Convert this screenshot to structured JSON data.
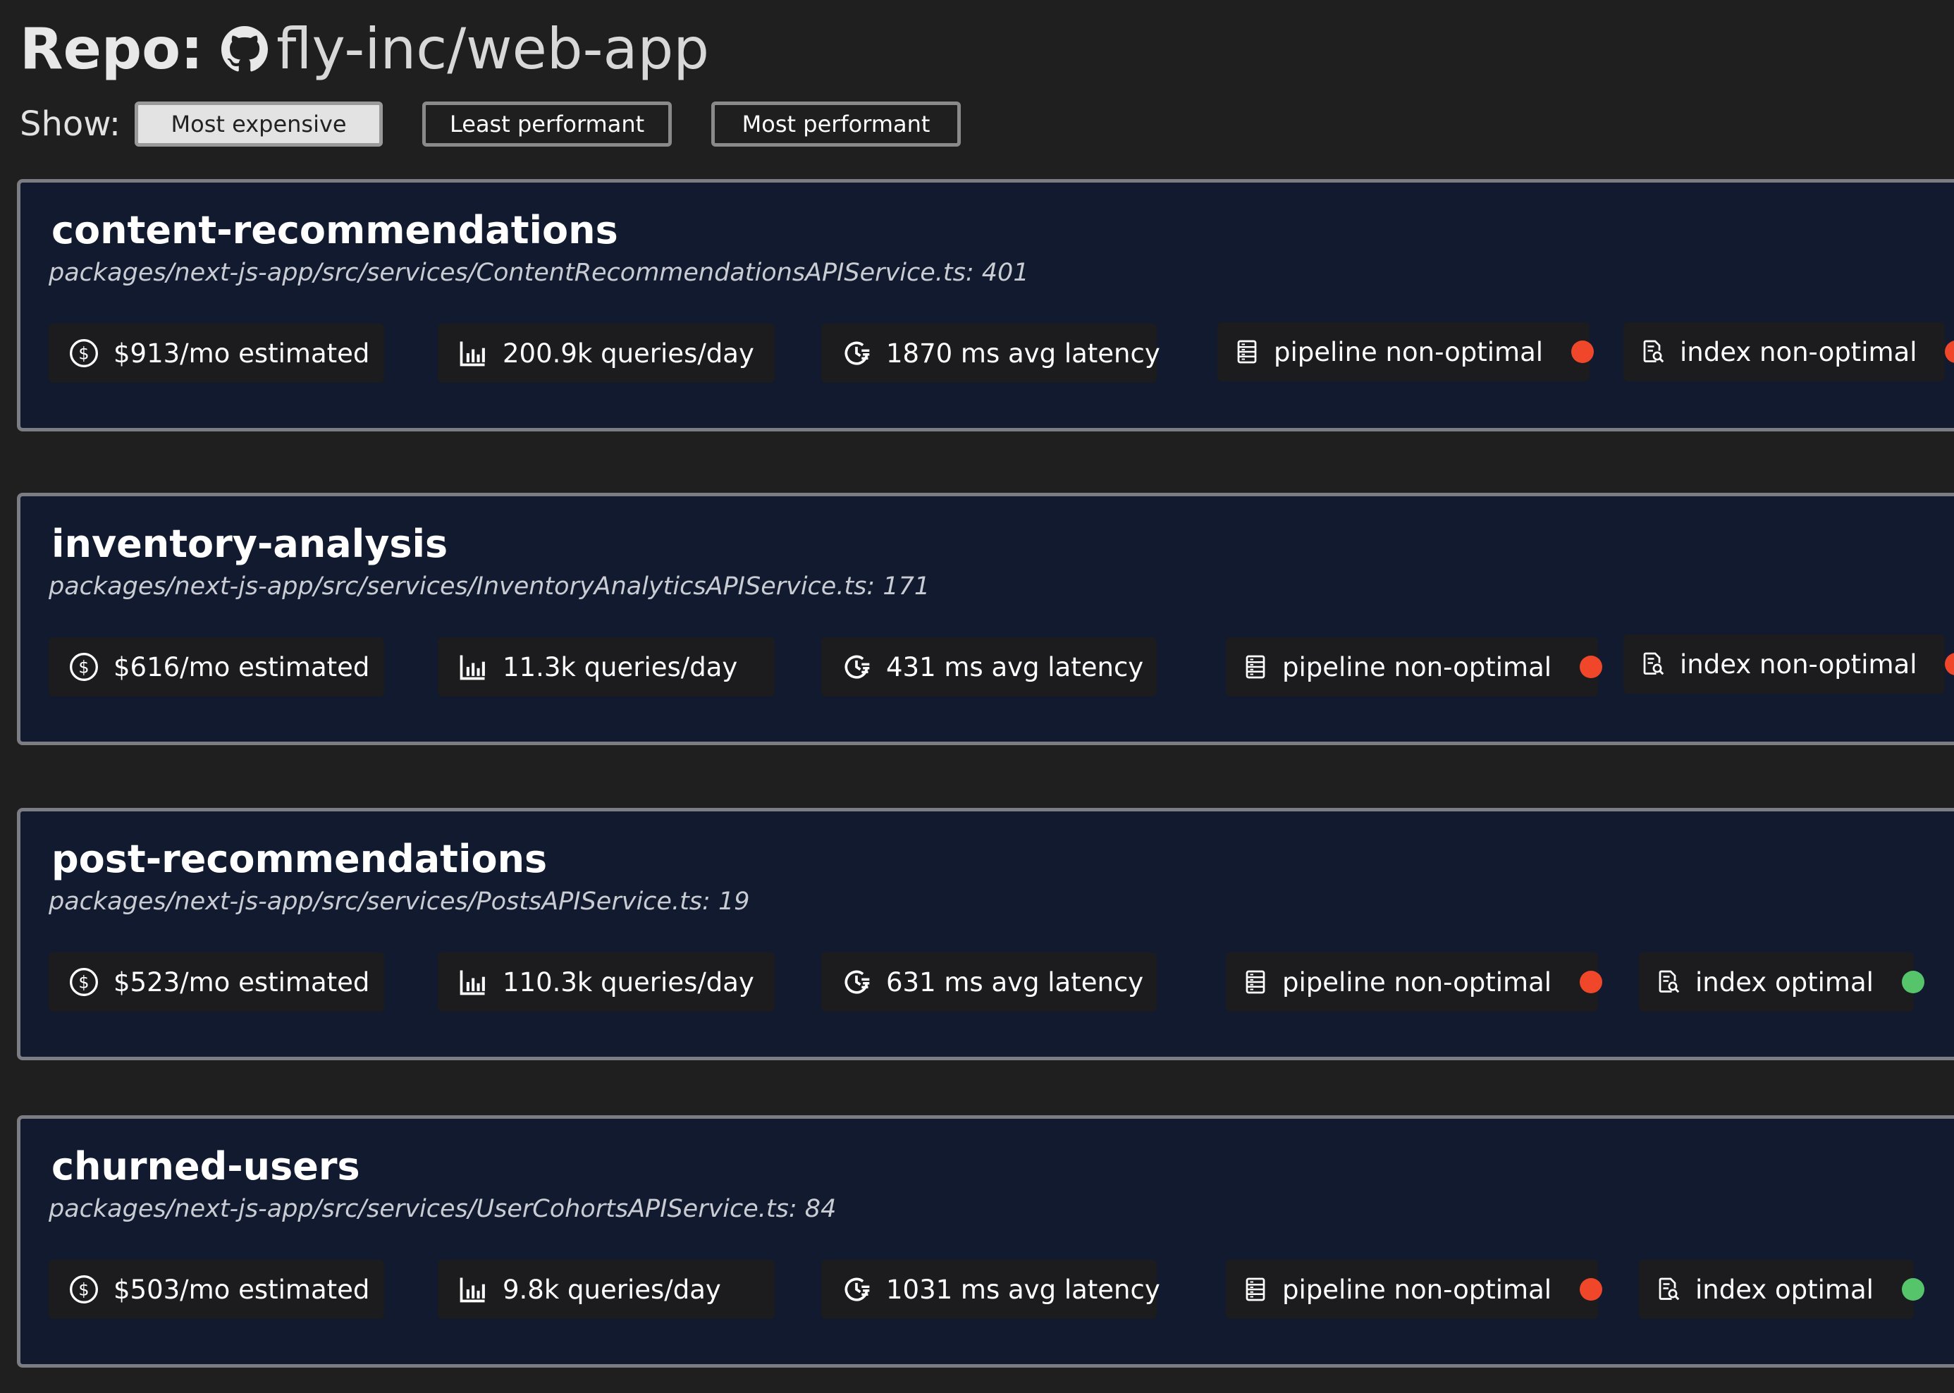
{
  "header": {
    "repo_prefix": "Repo:",
    "repo_icon": "github-icon",
    "repo_name": "fly-inc/web-app"
  },
  "filters": {
    "label": "Show:",
    "options": [
      {
        "label": "Most expensive",
        "active": true
      },
      {
        "label": "Least performant",
        "active": false
      },
      {
        "label": "Most performant",
        "active": false
      }
    ]
  },
  "colors": {
    "page_bg": "#1f1f1f",
    "card_bg": "#111a2e",
    "status_bad": "#f0472a",
    "status_good": "#56c46a"
  },
  "cards": [
    {
      "title": "content-recommendations",
      "path": "packages/next-js-app/src/services/ContentRecommendationsAPIService.ts: 401",
      "cost": "$913/mo estimated",
      "queries": "200.9k queries/day",
      "latency": "1870 ms avg latency",
      "pipeline": "pipeline non-optimal",
      "pipeline_status": "bad",
      "index": "index non-optimal",
      "index_status": "bad"
    },
    {
      "title": "inventory-analysis",
      "path": "packages/next-js-app/src/services/InventoryAnalyticsAPIService.ts: 171",
      "cost": "$616/mo estimated",
      "queries": "11.3k queries/day",
      "latency": "431 ms avg latency",
      "pipeline": "pipeline non-optimal",
      "pipeline_status": "bad",
      "index": "index non-optimal",
      "index_status": "bad"
    },
    {
      "title": "post-recommendations",
      "path": "packages/next-js-app/src/services/PostsAPIService.ts: 19",
      "cost": "$523/mo estimated",
      "queries": "110.3k queries/day",
      "latency": "631 ms avg latency",
      "pipeline": "pipeline non-optimal",
      "pipeline_status": "bad",
      "index": "index optimal",
      "index_status": "good"
    },
    {
      "title": "churned-users",
      "path": "packages/next-js-app/src/services/UserCohortsAPIService.ts: 84",
      "cost": "$503/mo estimated",
      "queries": "9.8k queries/day",
      "latency": "1031 ms avg latency",
      "pipeline": "pipeline non-optimal",
      "pipeline_status": "bad",
      "index": "index optimal",
      "index_status": "good"
    }
  ],
  "icons": {
    "cost": "dollar-circle-icon",
    "queries": "bar-chart-icon",
    "latency": "clock-speed-icon",
    "pipeline": "pipeline-list-icon",
    "index": "index-search-icon"
  }
}
